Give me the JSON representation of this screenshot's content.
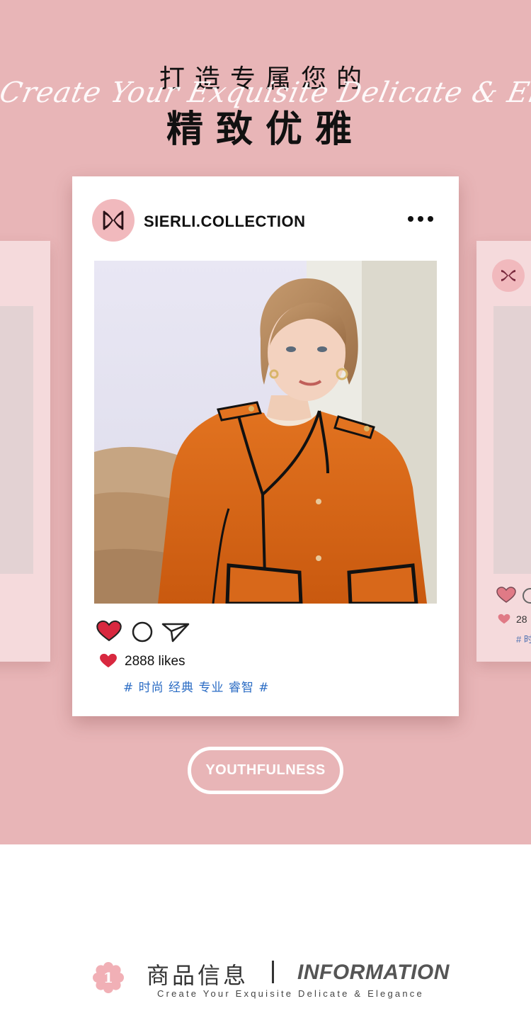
{
  "header": {
    "title_cn_line1": "打造专属您的",
    "title_script": "Create Your Exquisite Delicate & Elegance",
    "title_cn_line2": "精致优雅"
  },
  "post": {
    "handle": "SIERLI.COLLECTION",
    "more_icon": "more-dots-icon",
    "likes": "2888 likes",
    "tags": "# 时尚 经典 专业 睿智 #",
    "side_likes": "28",
    "side_tag": "# 时"
  },
  "cta": {
    "label": "YOUTHFULNESS"
  },
  "info": {
    "number": "1",
    "title_cn": "商品信息",
    "title_en": "INFORMATION",
    "subtitle": "Create Your Exquisite Delicate & Elegance"
  },
  "colors": {
    "background_pink": "#e8b5b7",
    "heart_red": "#d8283f",
    "tag_blue": "#2b6cc4",
    "avatar_pink": "#f1b9bd"
  }
}
